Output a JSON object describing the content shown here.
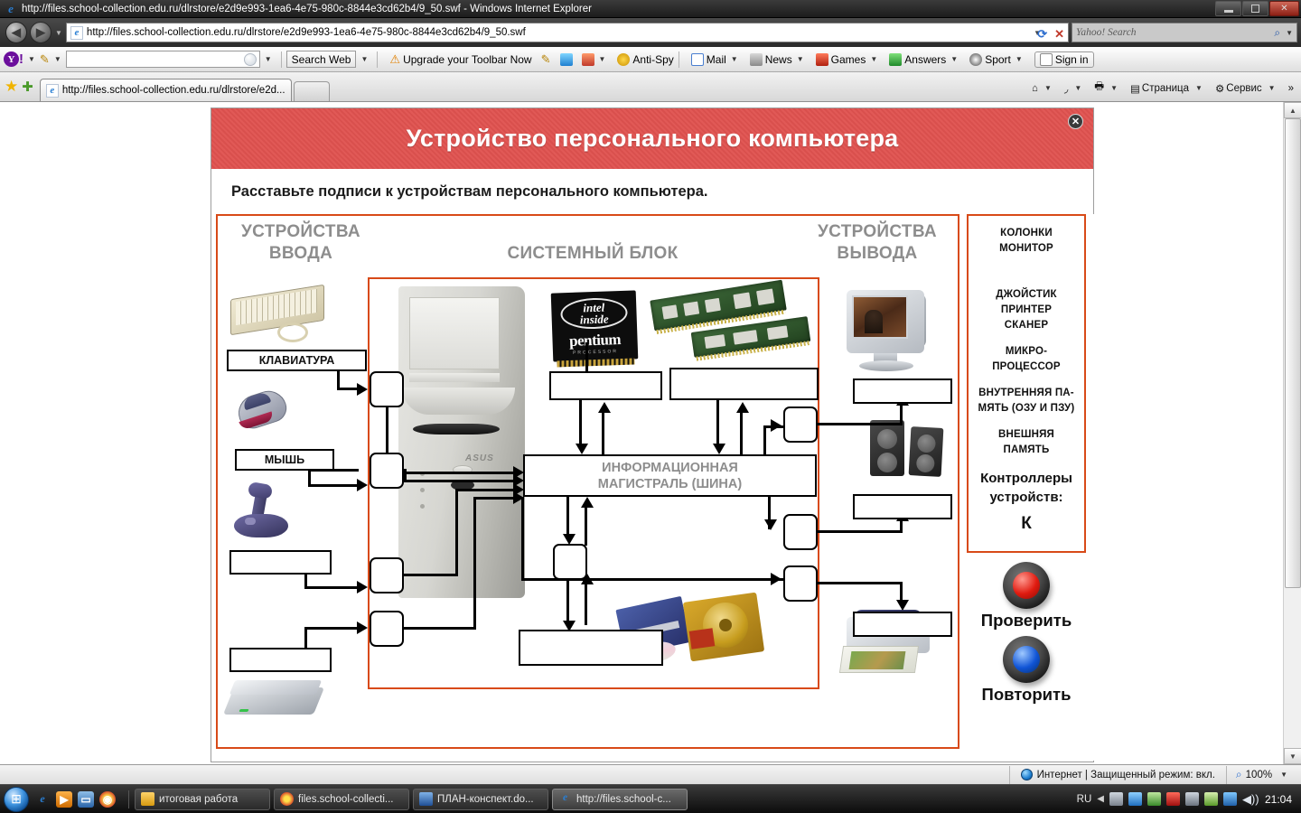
{
  "browser": {
    "window_title": "http://files.school-collection.edu.ru/dlrstore/e2d9e993-1ea6-4e75-980c-8844e3cd62b4/9_50.swf - Windows Internet Explorer",
    "address_value": "http://files.school-collection.edu.ru/dlrstore/e2d9e993-1ea6-4e75-980c-8844e3cd62b4/9_50.swf",
    "search_placeholder": "Yahoo! Search",
    "tab_label": "http://files.school-collection.edu.ru/dlrstore/e2d...",
    "minimize_label": "—",
    "restore_label": "❐",
    "close_label": "✕"
  },
  "yahoo_toolbar": {
    "logo": "Y",
    "bang": "!",
    "search_input_value": "",
    "search_web_label": "Search Web",
    "upgrade_label": "Upgrade your Toolbar Now",
    "items": [
      {
        "label": "Anti-Spy",
        "icon": "antispy-icon"
      },
      {
        "label": "Mail",
        "icon": "mail-icon"
      },
      {
        "label": "News",
        "icon": "news-icon"
      },
      {
        "label": "Games",
        "icon": "games-icon"
      },
      {
        "label": "Answers",
        "icon": "answers-icon"
      },
      {
        "label": "Sport",
        "icon": "sport-icon"
      },
      {
        "label": "Sign in",
        "icon": "signin-icon"
      }
    ]
  },
  "command_bar": {
    "home_label": "",
    "feeds_label": "",
    "print_label": "",
    "page_label": "Страница",
    "tools_label": "Сервис",
    "overflow_label": "»"
  },
  "slide": {
    "title": "Устройство персонального компьютера",
    "subtitle": "Расставьте подписи к  устройствам персонального компьютера.",
    "close_button": "✕"
  },
  "diagram": {
    "heading_input": "УСТРОЙСТВА\nВВОДА",
    "heading_input_line1": "УСТРОЙСТВА",
    "heading_input_line2": "ВВОДА",
    "heading_system_unit": "СИСТЕМНЫЙ БЛОК",
    "heading_output_line1": "УСТРОЙСТВА",
    "heading_output_line2": "ВЫВОДА",
    "bus_line1": "ИНФОРМАЦИОННАЯ",
    "bus_line2": "МАГИСТРАЛЬ (ШИНА)",
    "answer_boxes": [
      {
        "id": "input-keyboard",
        "value": "КЛАВИАТУРА",
        "filled": true
      },
      {
        "id": "input-mouse",
        "value": "МЫШЬ",
        "filled": true
      },
      {
        "id": "input-joystick",
        "value": "",
        "filled": false
      },
      {
        "id": "input-scanner",
        "value": "",
        "filled": false
      },
      {
        "id": "cpu-label",
        "value": "",
        "filled": false
      },
      {
        "id": "memory-label",
        "value": "",
        "filled": false
      },
      {
        "id": "external-memory-label",
        "value": "",
        "filled": false
      },
      {
        "id": "output-monitor",
        "value": "",
        "filled": false
      },
      {
        "id": "output-speakers",
        "value": "",
        "filled": false
      },
      {
        "id": "output-printer",
        "value": "",
        "filled": false
      }
    ],
    "controller_boxes": [
      {
        "id": "controller-keyboard",
        "value": ""
      },
      {
        "id": "controller-mouse",
        "value": ""
      },
      {
        "id": "controller-joystick",
        "value": ""
      },
      {
        "id": "controller-scanner",
        "value": ""
      },
      {
        "id": "controller-storage",
        "value": ""
      },
      {
        "id": "controller-monitor",
        "value": ""
      },
      {
        "id": "controller-speakers",
        "value": ""
      },
      {
        "id": "controller-printer",
        "value": ""
      }
    ],
    "images": [
      {
        "id": "keyboard-photo",
        "alt": "keyboard"
      },
      {
        "id": "mouse-photo",
        "alt": "mouse"
      },
      {
        "id": "joystick-photo",
        "alt": "joystick"
      },
      {
        "id": "scanner-photo",
        "alt": "scanner"
      },
      {
        "id": "system-unit-photo",
        "alt": "tower case"
      },
      {
        "id": "cpu-photo",
        "alt": "intel inside pentium processor"
      },
      {
        "id": "ram-photo",
        "alt": "memory modules"
      },
      {
        "id": "storage-photo",
        "alt": "floppy disk, cd and hard drive"
      },
      {
        "id": "monitor-photo",
        "alt": "CRT monitor"
      },
      {
        "id": "speakers-photo",
        "alt": "speakers"
      },
      {
        "id": "printer-photo",
        "alt": "inkjet printer"
      }
    ]
  },
  "wordbank": {
    "lines": [
      "КОЛОНКИ",
      "МОНИТОР"
    ],
    "lines2": [
      "ДЖОЙСТИК",
      "ПРИНТЕР",
      "СКАНЕР"
    ],
    "lines3": [
      "МИКРО-",
      "ПРОЦЕССОР"
    ],
    "lines4": [
      "ВНУТРЕННЯЯ ПА-",
      "МЯТЬ (ОЗУ И ПЗУ)"
    ],
    "lines5": [
      "ВНЕШНЯЯ",
      "ПАМЯТЬ"
    ],
    "title_big1": "Контроллеры",
    "title_big2": "устройств:",
    "letter": "К"
  },
  "buttons": {
    "check_label": "Проверить",
    "repeat_label": "Повторить",
    "check_color": "#e01b10",
    "repeat_color": "#1054d6"
  },
  "statusbar": {
    "zone_text": "Интернет | Защищенный режим: вкл.",
    "zoom_text": "100%"
  },
  "taskbar": {
    "start_label": "⊞",
    "quicklaunch": [
      {
        "name": "ie-quicklaunch-icon",
        "glyph": "e",
        "color": "#2a7fd4"
      },
      {
        "name": "media-player-icon",
        "glyph": "▶",
        "color": "#e08000"
      },
      {
        "name": "show-desktop-icon",
        "glyph": "▭",
        "color": "#4a8ccc"
      },
      {
        "name": "chrome-quicklaunch-icon",
        "glyph": "◉",
        "color": "#d94f2b"
      }
    ],
    "tasks": [
      {
        "label": "итоговая работа",
        "icon": "folder-icon",
        "active": false
      },
      {
        "label": "files.school-collecti...",
        "icon": "chrome-icon",
        "active": false
      },
      {
        "label": "ПЛАН-конспект.do...",
        "icon": "word-icon",
        "active": false
      },
      {
        "label": "http://files.school-c...",
        "icon": "ie-icon",
        "active": true
      }
    ],
    "language": "RU",
    "clock": "21:04",
    "tray_icons": [
      "show-hidden-icons-arrow",
      "usb-safe-remove-icon",
      "flash-update-icon",
      "network-activity-icon",
      "kaspersky-icon",
      "display-icon",
      "power-icon",
      "network-icon",
      "volume-icon"
    ]
  }
}
